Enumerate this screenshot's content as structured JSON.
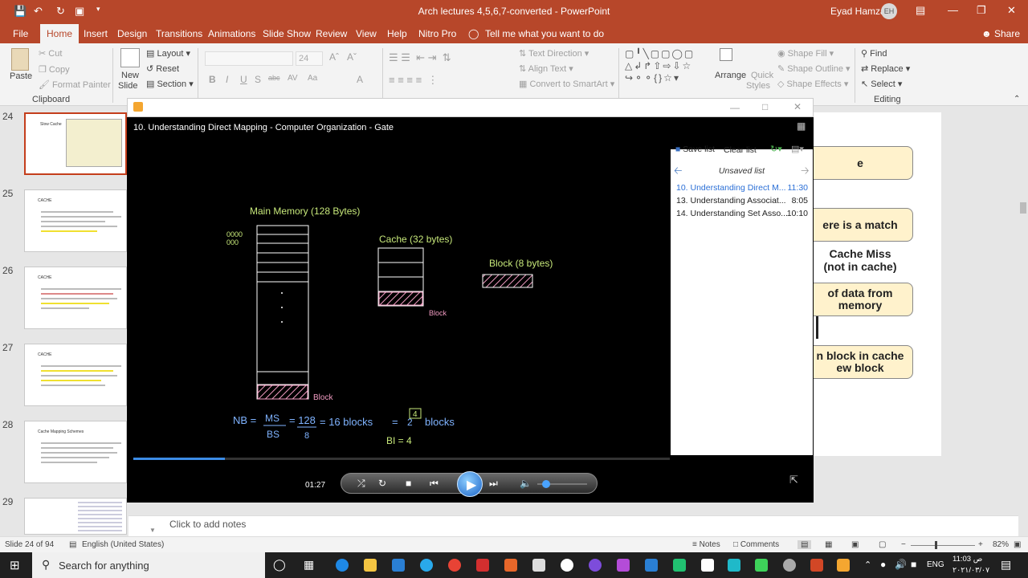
{
  "app": {
    "window_title": "Arch lectures 4,5,6,7-converted  -  PowerPoint",
    "user_name": "Eyad Hamza",
    "user_initials": "EH"
  },
  "menu": {
    "file": "File",
    "home": "Home",
    "insert": "Insert",
    "design": "Design",
    "transitions": "Transitions",
    "animations": "Animations",
    "slideshow": "Slide Show",
    "review": "Review",
    "view": "View",
    "help": "Help",
    "nitro": "Nitro Pro",
    "tellme": "Tell me what you want to do",
    "share": "Share"
  },
  "ribbon": {
    "paste": "Paste",
    "cut": "Cut",
    "copy": "Copy",
    "format_painter": "Format Painter",
    "clipboard": "Clipboard",
    "new_slide_1": "New",
    "new_slide_2": "Slide",
    "layout": "Layout",
    "reset": "Reset",
    "section": "Section",
    "font_size": "24",
    "text_direction": "Text Direction",
    "align_text": "Align Text",
    "smartart": "Convert to SmartArt",
    "arrange": "Arrange",
    "quick_styles_1": "Quick",
    "quick_styles_2": "Styles",
    "shape_fill": "Shape Fill",
    "shape_outline": "Shape Outline",
    "shape_effects": "Shape Effects",
    "find": "Find",
    "replace": "Replace",
    "select": "Select",
    "editing": "Editing"
  },
  "thumbnails": [
    {
      "num": "24",
      "title": "Slow Cache"
    },
    {
      "num": "25",
      "title": "CACHE"
    },
    {
      "num": "26",
      "title": "CACHE"
    },
    {
      "num": "27",
      "title": "CACHE"
    },
    {
      "num": "28",
      "title": "Cache Mapping Schemes"
    },
    {
      "num": "29",
      "title": ""
    }
  ],
  "slide_boxes": {
    "match": "ere is a match",
    "miss_1": "Cache Miss",
    "miss_2": "(not in cache)",
    "data_1": "of data from",
    "data_2": "memory",
    "block_1": "n block in cache",
    "block_2": "ew block"
  },
  "player": {
    "video_title": "10. Understanding Direct Mapping - Computer Organization - Gate",
    "save_list": "Save list",
    "clear_list": "Clear list",
    "unsaved_list": "Unsaved list",
    "playlist": [
      {
        "name": "10. Understanding Direct M...",
        "time": "11:30",
        "current": true
      },
      {
        "name": "13. Understanding Associat...",
        "time": "8:05",
        "current": false
      },
      {
        "name": "14. Understanding Set Asso...",
        "time": "10:10",
        "current": false
      }
    ],
    "elapsed": "01:27",
    "progress": 0.17,
    "volume": 0.1
  },
  "video_content": {
    "main_memory": "Main Memory (128 Bytes)",
    "cache": "Cache (32 bytes)",
    "block_label": "Block (8 bytes)",
    "block_a": "Block",
    "block_b": "Block",
    "addr_1": "0000",
    "addr_2": "000",
    "formula_nb": "NB =",
    "formula_ms": "MS",
    "formula_bs": "BS",
    "formula_128": "= 128",
    "formula_8": "8",
    "formula_16": "= 16 blocks",
    "formula_eq": "=",
    "formula_2": "2",
    "formula_4": "4",
    "formula_blocks": "blocks",
    "bi": "BI = 4"
  },
  "notes": {
    "placeholder": "Click to add notes"
  },
  "status": {
    "slide": "Slide 24 of 94",
    "language": "English (United States)",
    "notes": "Notes",
    "comments": "Comments",
    "zoom": "82%"
  },
  "taskbar": {
    "search": "Search for anything",
    "lang": "ENG",
    "time": "11:03 ص",
    "date": "٢٠٢١/٠٣/٠٧"
  },
  "colors": {
    "ppt_accent": "#b7472a",
    "chalk_green": "#c7e87a",
    "chalk_pink": "#f29cc2",
    "chalk_blue": "#7fb3ff"
  }
}
